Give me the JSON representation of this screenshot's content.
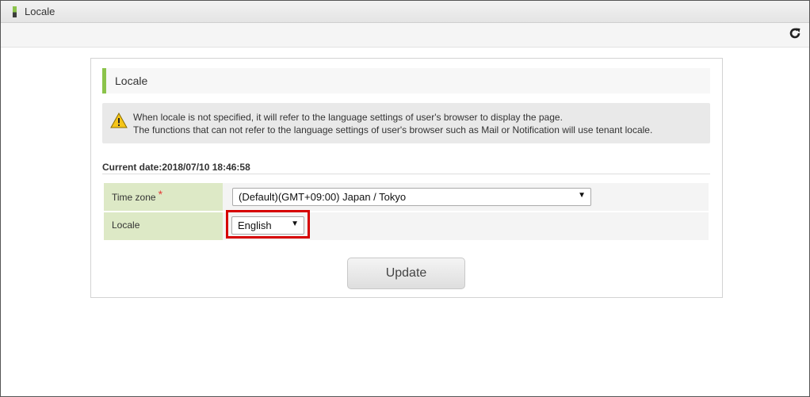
{
  "window": {
    "title": "Locale"
  },
  "panel": {
    "header": "Locale",
    "warning": {
      "line1": "When locale is not specified, it will refer to the language settings of user's browser to display the page.",
      "line2": "The functions that can not refer to the language settings of user's browser such as Mail or Notification will use tenant locale."
    },
    "current_date": "Current date:2018/07/10 18:46:58",
    "form": {
      "timezone": {
        "label": "Time zone",
        "required_mark": "*",
        "value": "(Default)(GMT+09:00) Japan / Tokyo"
      },
      "locale": {
        "label": "Locale",
        "value": "English"
      }
    },
    "update_label": "Update"
  },
  "colors": {
    "accent": "#8bc34a",
    "highlight": "#d60000",
    "required": "#e53935"
  },
  "icons": {
    "refresh": "refresh-icon",
    "warning": "warning-icon"
  }
}
